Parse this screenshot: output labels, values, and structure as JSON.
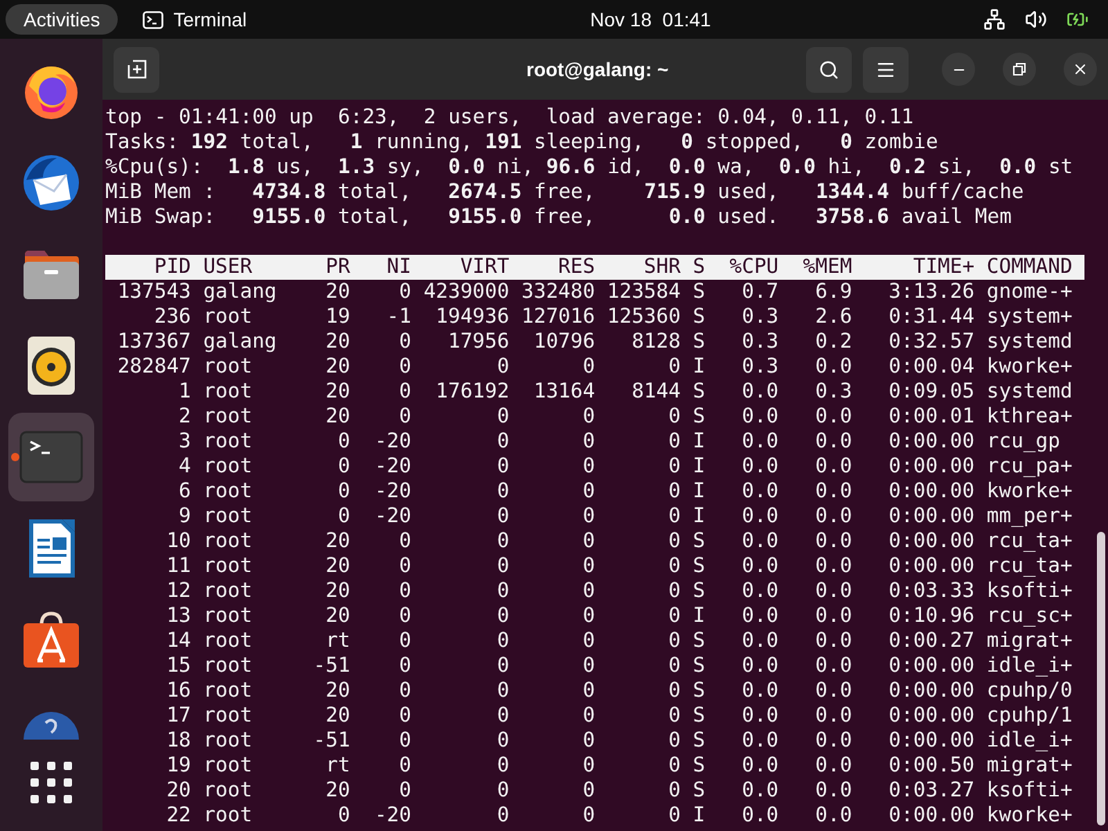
{
  "top_bar": {
    "activities": "Activities",
    "app_name": "Terminal",
    "clock": "Nov 18  01:41"
  },
  "dock": {
    "items": [
      {
        "kind": "browser",
        "selected": false,
        "running": false
      },
      {
        "kind": "mail",
        "selected": false,
        "running": false
      },
      {
        "kind": "files",
        "selected": false,
        "running": false
      },
      {
        "kind": "music",
        "selected": false,
        "running": false
      },
      {
        "kind": "terminal",
        "selected": true,
        "running": true
      },
      {
        "kind": "writer",
        "selected": false,
        "running": false
      },
      {
        "kind": "store",
        "selected": false,
        "running": false
      },
      {
        "kind": "help",
        "selected": false,
        "running": false
      }
    ]
  },
  "window": {
    "title": "root@galang: ~"
  },
  "terminal": {
    "summary_lines": [
      "top - 01:41:00 up  6:23,  2 users,  load average: 0.04, 0.11, 0.11",
      "Tasks: **192** total,   **1** running, **191** sleeping,   **0** stopped,   **0** zombie",
      "%Cpu(s):  **1.8** us,  **1.3** sy,  **0.0** ni, **96.6** id,  **0.0** wa,  **0.0** hi,  **0.2** si,  **0.0** st",
      "MiB Mem :   **4734.8** total,   **2674.5** free,    **715.9** used,   **1344.4** buff/cache",
      "MiB Swap:   **9155.0** total,   **9155.0** free,      **0.0** used.   **3758.6** avail Mem"
    ],
    "table": {
      "columns": [
        "PID",
        "USER",
        "PR",
        "NI",
        "VIRT",
        "RES",
        "SHR",
        "S",
        "%CPU",
        "%MEM",
        "TIME+",
        "COMMAND"
      ],
      "rows": [
        [
          "137543",
          "galang",
          "20",
          "0",
          "4239000",
          "332480",
          "123584",
          "S",
          "0.7",
          "6.9",
          "3:13.26",
          "gnome-+"
        ],
        [
          "236",
          "root",
          "19",
          "-1",
          "194936",
          "127016",
          "125360",
          "S",
          "0.3",
          "2.6",
          "0:31.44",
          "system+"
        ],
        [
          "137367",
          "galang",
          "20",
          "0",
          "17956",
          "10796",
          "8128",
          "S",
          "0.3",
          "0.2",
          "0:32.57",
          "systemd"
        ],
        [
          "282847",
          "root",
          "20",
          "0",
          "0",
          "0",
          "0",
          "I",
          "0.3",
          "0.0",
          "0:00.04",
          "kworke+"
        ],
        [
          "1",
          "root",
          "20",
          "0",
          "176192",
          "13164",
          "8144",
          "S",
          "0.0",
          "0.3",
          "0:09.05",
          "systemd"
        ],
        [
          "2",
          "root",
          "20",
          "0",
          "0",
          "0",
          "0",
          "S",
          "0.0",
          "0.0",
          "0:00.01",
          "kthrea+"
        ],
        [
          "3",
          "root",
          "0",
          "-20",
          "0",
          "0",
          "0",
          "I",
          "0.0",
          "0.0",
          "0:00.00",
          "rcu_gp"
        ],
        [
          "4",
          "root",
          "0",
          "-20",
          "0",
          "0",
          "0",
          "I",
          "0.0",
          "0.0",
          "0:00.00",
          "rcu_pa+"
        ],
        [
          "6",
          "root",
          "0",
          "-20",
          "0",
          "0",
          "0",
          "I",
          "0.0",
          "0.0",
          "0:00.00",
          "kworke+"
        ],
        [
          "9",
          "root",
          "0",
          "-20",
          "0",
          "0",
          "0",
          "I",
          "0.0",
          "0.0",
          "0:00.00",
          "mm_per+"
        ],
        [
          "10",
          "root",
          "20",
          "0",
          "0",
          "0",
          "0",
          "S",
          "0.0",
          "0.0",
          "0:00.00",
          "rcu_ta+"
        ],
        [
          "11",
          "root",
          "20",
          "0",
          "0",
          "0",
          "0",
          "S",
          "0.0",
          "0.0",
          "0:00.00",
          "rcu_ta+"
        ],
        [
          "12",
          "root",
          "20",
          "0",
          "0",
          "0",
          "0",
          "S",
          "0.0",
          "0.0",
          "0:03.33",
          "ksofti+"
        ],
        [
          "13",
          "root",
          "20",
          "0",
          "0",
          "0",
          "0",
          "I",
          "0.0",
          "0.0",
          "0:10.96",
          "rcu_sc+"
        ],
        [
          "14",
          "root",
          "rt",
          "0",
          "0",
          "0",
          "0",
          "S",
          "0.0",
          "0.0",
          "0:00.27",
          "migrat+"
        ],
        [
          "15",
          "root",
          "-51",
          "0",
          "0",
          "0",
          "0",
          "S",
          "0.0",
          "0.0",
          "0:00.00",
          "idle_i+"
        ],
        [
          "16",
          "root",
          "20",
          "0",
          "0",
          "0",
          "0",
          "S",
          "0.0",
          "0.0",
          "0:00.00",
          "cpuhp/0"
        ],
        [
          "17",
          "root",
          "20",
          "0",
          "0",
          "0",
          "0",
          "S",
          "0.0",
          "0.0",
          "0:00.00",
          "cpuhp/1"
        ],
        [
          "18",
          "root",
          "-51",
          "0",
          "0",
          "0",
          "0",
          "S",
          "0.0",
          "0.0",
          "0:00.00",
          "idle_i+"
        ],
        [
          "19",
          "root",
          "rt",
          "0",
          "0",
          "0",
          "0",
          "S",
          "0.0",
          "0.0",
          "0:00.50",
          "migrat+"
        ],
        [
          "20",
          "root",
          "20",
          "0",
          "0",
          "0",
          "0",
          "S",
          "0.0",
          "0.0",
          "0:03.27",
          "ksofti+"
        ],
        [
          "22",
          "root",
          "0",
          "-20",
          "0",
          "0",
          "0",
          "I",
          "0.0",
          "0.0",
          "0:00.00",
          "kworke+"
        ]
      ]
    }
  }
}
